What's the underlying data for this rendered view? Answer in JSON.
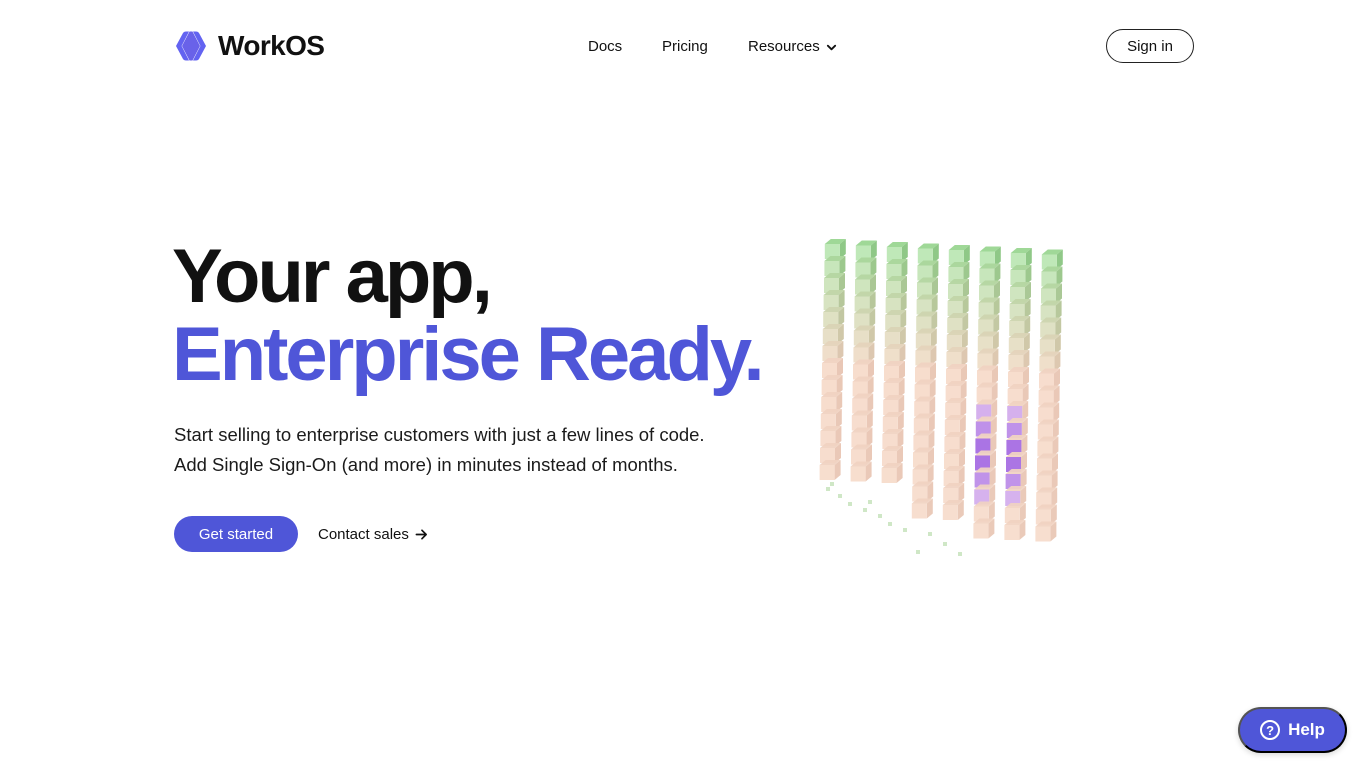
{
  "brand": {
    "name": "WorkOS",
    "color": "#4f56d8"
  },
  "nav": {
    "docs": "Docs",
    "pricing": "Pricing",
    "resources": "Resources",
    "sign_in": "Sign in"
  },
  "hero": {
    "title_line1": "Your app,",
    "title_line2": "Enterprise Ready.",
    "subtitle_line1": "Start selling to enterprise customers with just a few lines of code.",
    "subtitle_line2": "Add Single Sign-On (and more) in minutes instead of months.",
    "primary_cta": "Get started",
    "secondary_cta": "Contact sales"
  },
  "help": {
    "label": "Help",
    "icon": "?"
  },
  "icons": {
    "logo": "workos-logo-icon",
    "resources_chevron": "chevron-down-icon",
    "contact_arrow": "arrow-right-icon",
    "help": "question-circle-icon"
  }
}
